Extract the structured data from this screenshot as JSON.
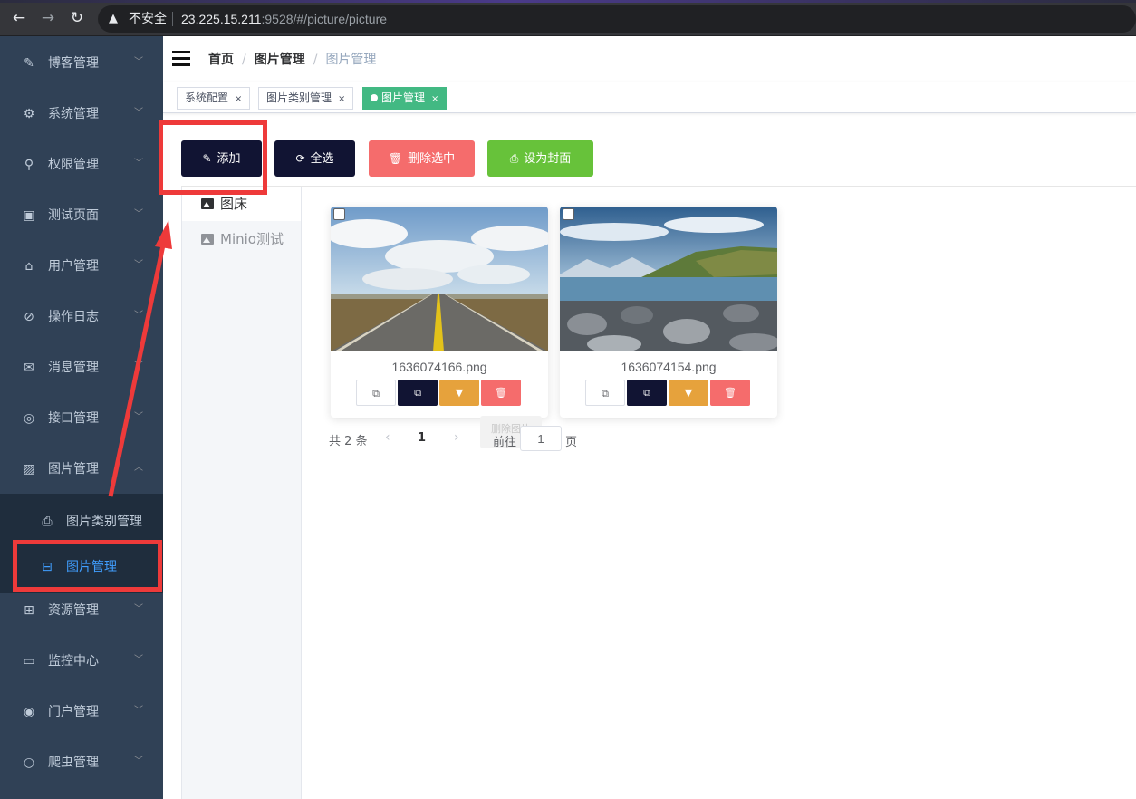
{
  "browser": {
    "security_label": "不安全",
    "url_host": "23.225.15.211",
    "url_rest": ":9528/#/picture/picture"
  },
  "sidebar": {
    "items": [
      {
        "label": "博客管理",
        "icon": "edit-icon"
      },
      {
        "label": "系统管理",
        "icon": "gear-icon"
      },
      {
        "label": "权限管理",
        "icon": "user-icon"
      },
      {
        "label": "测试页面",
        "icon": "chip-icon"
      },
      {
        "label": "用户管理",
        "icon": "home-icon"
      },
      {
        "label": "操作日志",
        "icon": "paperclip-icon"
      },
      {
        "label": "消息管理",
        "icon": "message-icon"
      },
      {
        "label": "接口管理",
        "icon": "compass-icon"
      },
      {
        "label": "图片管理",
        "icon": "picture-icon"
      },
      {
        "label": "资源管理",
        "icon": "box-icon"
      },
      {
        "label": "监控中心",
        "icon": "monitor-icon"
      },
      {
        "label": "门户管理",
        "icon": "lifebuoy-icon"
      },
      {
        "label": "爬虫管理",
        "icon": "search-icon"
      }
    ],
    "submenu": [
      {
        "label": "图片类别管理",
        "icon": "printer-icon"
      },
      {
        "label": "图片管理",
        "icon": "cast-icon",
        "active": true
      }
    ]
  },
  "breadcrumb": [
    "首页",
    "图片管理",
    "图片管理"
  ],
  "tags": [
    {
      "label": "系统配置"
    },
    {
      "label": "图片类别管理"
    },
    {
      "label": "图片管理",
      "active": true
    }
  ],
  "toolbar": {
    "add": "添加",
    "select_all": "全选",
    "delete_selected": "删除选中",
    "set_cover": "设为封面"
  },
  "colors": {
    "add": "#111433",
    "select_all": "#111433",
    "delete_selected": "#f56c6c",
    "set_cover": "#67c23a",
    "active_tag": "#42b983",
    "annotation": "#ee3a3a"
  },
  "storage_tabs": [
    {
      "label": "图床",
      "active": true
    },
    {
      "label": "Minio测试"
    }
  ],
  "pictures": [
    {
      "filename": "1636074166.png",
      "scene": "road-under-cloudy-sky"
    },
    {
      "filename": "1636074154.png",
      "scene": "rocky-shore-and-mountains"
    }
  ],
  "tooltip": "删除图片",
  "pagination": {
    "total": "共 2 条",
    "current": "1",
    "goto_label": "前往",
    "goto_value": "1",
    "unit": "页"
  }
}
